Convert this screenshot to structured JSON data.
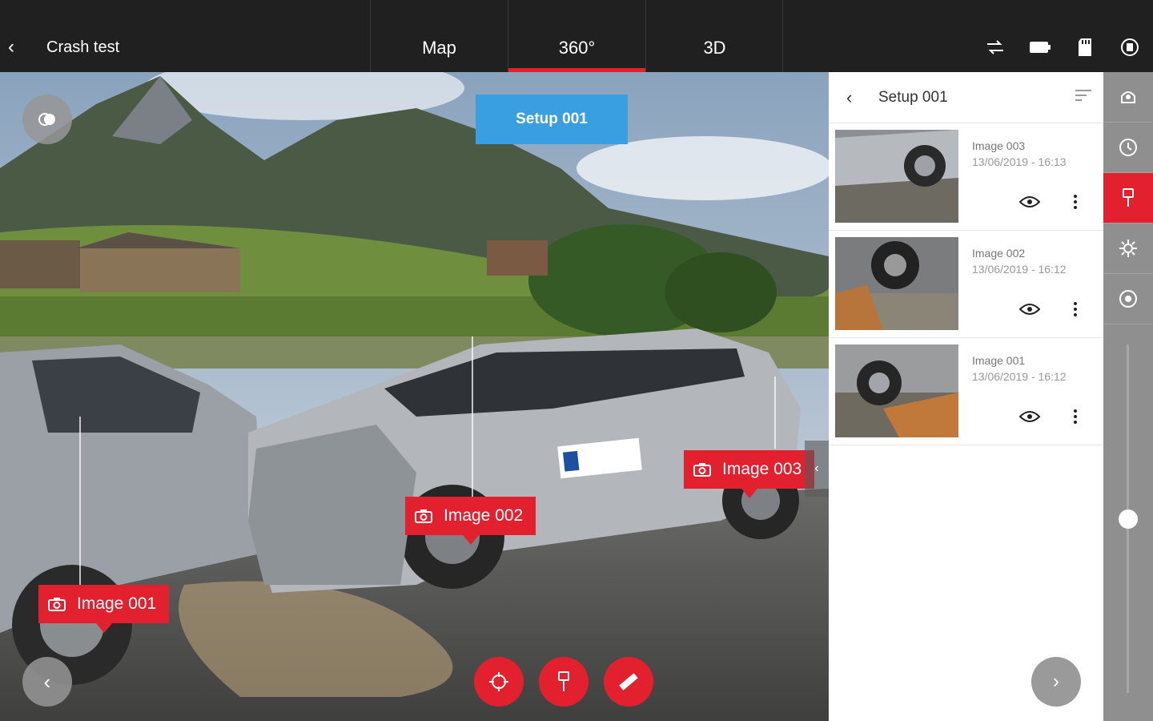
{
  "header": {
    "back_glyph": "‹",
    "title": "Crash test",
    "tabs": [
      {
        "label": "Map",
        "active": false
      },
      {
        "label": "360°",
        "active": true
      },
      {
        "label": "3D",
        "active": false
      }
    ],
    "status_icons": [
      "sync-icon",
      "battery-icon",
      "sd-card-icon",
      "device-icon"
    ]
  },
  "viewer": {
    "setup_label": "Setup 001",
    "image_tags": [
      "Image 001",
      "Image 002",
      "Image 003"
    ],
    "prev_glyph": "‹",
    "collapse_glyph": "‹",
    "tools": [
      "target-icon",
      "pin-icon",
      "ruler-icon"
    ]
  },
  "panel": {
    "back_glyph": "‹",
    "title": "Setup 001",
    "items": [
      {
        "title": "Image 003",
        "date": "13/06/2019 - 16:13"
      },
      {
        "title": "Image 002",
        "date": "13/06/2019 - 16:12"
      },
      {
        "title": "Image 001",
        "date": "13/06/2019 - 16:12"
      }
    ],
    "next_glyph": "›"
  },
  "toolcol": {
    "tools": [
      "scan-icon",
      "history-icon",
      "pin-icon",
      "settings-icon",
      "target-settings-icon"
    ],
    "active_index": 2
  },
  "colors": {
    "accent": "#e3202e",
    "setup_blue": "#3a9fe0",
    "topbar": "#202020"
  }
}
